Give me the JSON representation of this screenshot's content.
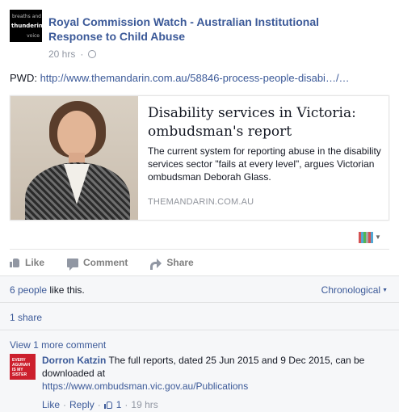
{
  "post": {
    "page_avatar": {
      "line1": "breaths and",
      "line2": "thundering",
      "line3": "voice"
    },
    "page_name": "Royal Commission Watch - Australian Institutional Response to Child Abuse",
    "time": "20 hrs",
    "sep": "·",
    "privacy_icon": "globe-icon",
    "text_prefix": "PWD:",
    "text_link": "http://www.themandarin.com.au/58846-process-people-disabi…/…"
  },
  "preview": {
    "title": "Disability services in Victoria: ombudsman's report",
    "description": "The current system for reporting abuse in the disability services sector \"fails at every level\", argues Victorian ombudsman Deborah Glass.",
    "domain": "THEMANDARIN.COM.AU"
  },
  "actions": {
    "like": "Like",
    "comment": "Comment",
    "share": "Share"
  },
  "ufi": {
    "likers": "6 people",
    "likers_suffix": "like this.",
    "sort_label": "Chronological",
    "shares": "1 share",
    "more_comments": "View 1 more comment"
  },
  "comment": {
    "avatar_lines": [
      "EVERY",
      "AGUNAH",
      "IS MY",
      "SISTER"
    ],
    "author": "Dorron Katzin",
    "text": "The full reports, dated 25 Jun 2015 and 9 Dec 2015, can be downloaded at",
    "link": "https://www.ombudsman.vic.gov.au/Publications",
    "like": "Like",
    "reply": "Reply",
    "sep": "·",
    "like_count": "1",
    "time": "19 hrs"
  }
}
